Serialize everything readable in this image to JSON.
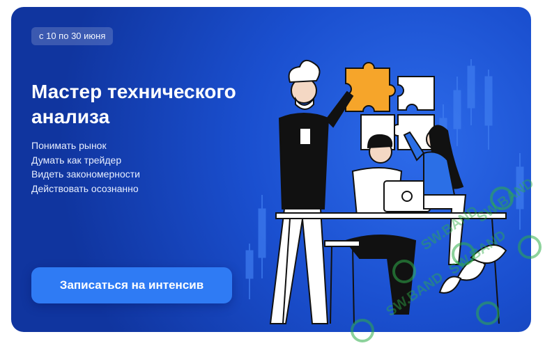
{
  "promo": {
    "date_badge": "с 10 по 30 июня",
    "title_line1": "Мастер технического",
    "title_line2": "анализа",
    "bullets": [
      "Понимать рынок",
      "Думать как трейдер",
      "Видеть закономерности",
      "Действовать осознанно"
    ],
    "cta_label": "Записаться на интенсив"
  },
  "watermark": {
    "text": "SW.BAND"
  },
  "colors": {
    "background": "#1a4fcf",
    "button": "#2f7bf4",
    "puzzle_accent": "#f6a52a",
    "watermark": "#2fae4a"
  },
  "illustration": {
    "icons": [
      "candlestick-chart-icon",
      "puzzle-piece-icon",
      "laptop-icon",
      "coffee-cup-icon",
      "plant-icon"
    ]
  }
}
